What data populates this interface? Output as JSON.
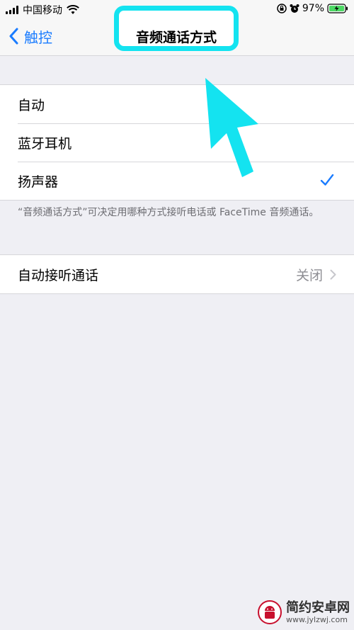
{
  "status_bar": {
    "carrier": "中国移动",
    "time": "",
    "battery_percent": "97%"
  },
  "nav": {
    "back_label": "触控",
    "title": "音频通话方式"
  },
  "audio_routing": {
    "options": [
      {
        "label": "自动",
        "selected": false
      },
      {
        "label": "蓝牙耳机",
        "selected": false
      },
      {
        "label": "扬声器",
        "selected": true
      }
    ],
    "footnote": "“音频通话方式”可决定用哪种方式接听电话或 FaceTime 音频通话。"
  },
  "auto_answer": {
    "label": "自动接听通话",
    "value": "关闭"
  },
  "watermark": {
    "name": "简约安卓网",
    "url": "www.jylzwj.com"
  },
  "colors": {
    "accent": "#1a7cff",
    "highlight": "#14e3f0",
    "background": "#efeff4"
  }
}
